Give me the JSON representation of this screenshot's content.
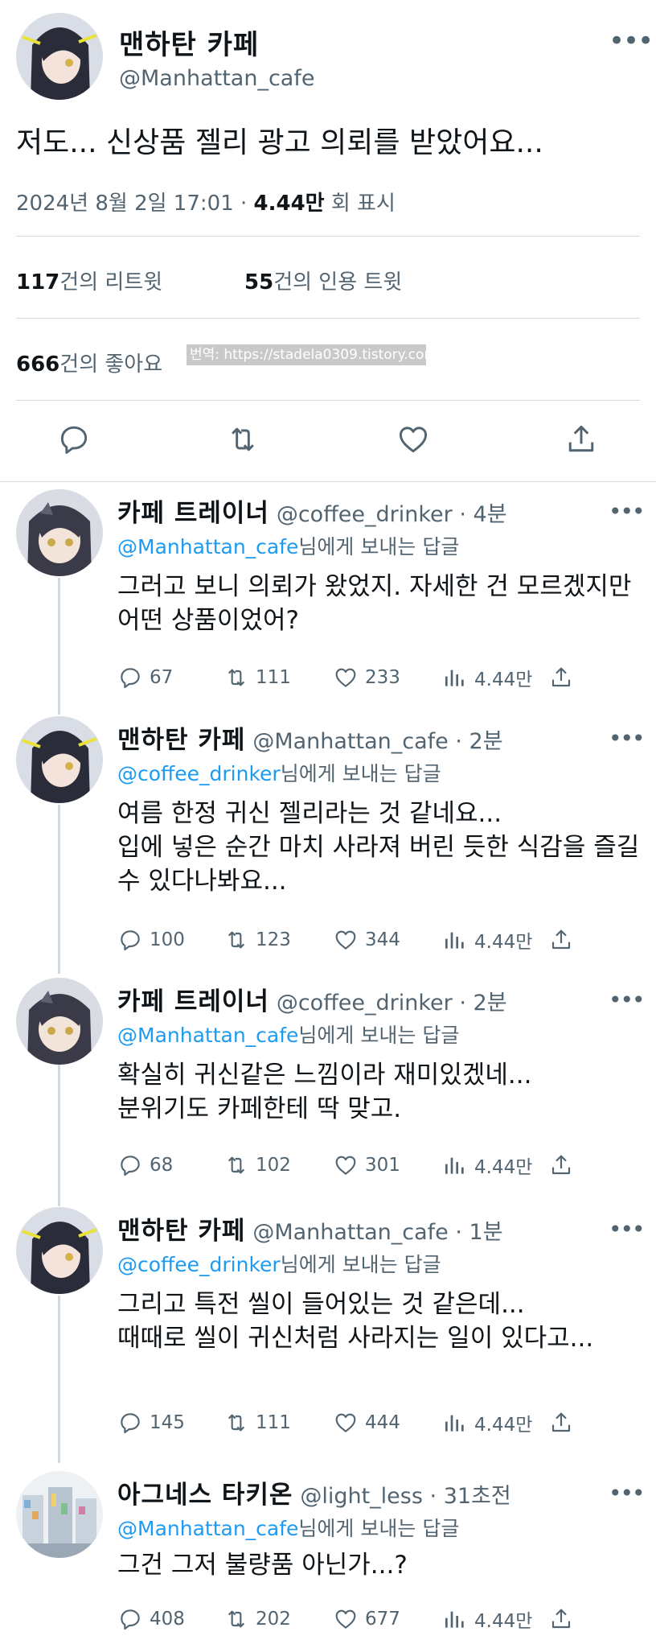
{
  "main_tweet": {
    "name": "맨하탄 카페",
    "handle": "@Manhattan_cafe",
    "text": "저도... 신상품 젤리 광고 의뢰를 받았어요...",
    "date": "2024년 8월 2일  17:01 · ",
    "views_count": "4.44만",
    "views_label": " 회 표시",
    "retweets_count": "117",
    "retweets_label": "건의 리트윗",
    "quotes_count": "55",
    "quotes_label": "건의 인용 트윗",
    "likes_count": "666",
    "likes_label": "건의 좋아요",
    "watermark": "번역: https://stadela0309.tistory.com",
    "more_icon": "more-dots-icon",
    "actions": [
      "reply-icon",
      "retweet-icon",
      "like-icon",
      "share-icon"
    ]
  },
  "replies": [
    {
      "name": "카페 트레이너",
      "handle": "@coffee_drinker",
      "dot": " · ",
      "time": "4분",
      "reply_to_mention": "@Manhattan_cafe",
      "reply_to_suffix": "님에게 보내는 답글",
      "text": "그러고 보니 의뢰가 왔었지. 자세한 건 모르겠지만 어떤 상품이었어?",
      "replies": "67",
      "retweets": "111",
      "likes": "233",
      "views": "4.44만"
    },
    {
      "name": "맨하탄 카페",
      "handle": "@Manhattan_cafe",
      "dot": " · ",
      "time": "2분",
      "reply_to_mention": "@coffee_drinker",
      "reply_to_suffix": "님에게 보내는 답글",
      "text": "여름 한정 귀신 젤리라는 것 같네요...\n입에 넣은 순간 마치 사라져 버린 듯한 식감을 즐길 수 있다나봐요...",
      "replies": "100",
      "retweets": "123",
      "likes": "344",
      "views": "4.44만"
    },
    {
      "name": "카페 트레이너",
      "handle": "@coffee_drinker",
      "dot": " · ",
      "time": "2분",
      "reply_to_mention": "@Manhattan_cafe",
      "reply_to_suffix": "님에게 보내는 답글",
      "text": "확실히 귀신같은 느낌이라 재미있겠네...\n분위기도 카페한테 딱 맞고.",
      "replies": "68",
      "retweets": "102",
      "likes": "301",
      "views": "4.44만"
    },
    {
      "name": "맨하탄 카페",
      "handle": "@Manhattan_cafe",
      "dot": " · ",
      "time": "1분",
      "reply_to_mention": "@coffee_drinker",
      "reply_to_suffix": "님에게 보내는 답글",
      "text": "그리고 특전 씰이 들어있는 것 같은데...\n때때로 씰이 귀신처럼 사라지는 일이 있다고...",
      "replies": "145",
      "retweets": "111",
      "likes": "444",
      "views": "4.44만"
    },
    {
      "name": "아그네스 타키온",
      "handle": "@light_less",
      "dot": " · ",
      "time": "31초전",
      "reply_to_mention": "@Manhattan_cafe",
      "reply_to_suffix": "님에게 보내는 답글",
      "text": "그건 그저 불량품 아닌가...?",
      "replies": "408",
      "retweets": "202",
      "likes": "677",
      "views": "4.44만"
    }
  ],
  "colors": {
    "accent": "#1d9bf0",
    "secondary_text": "#536471",
    "divider": "#d3d9de"
  }
}
